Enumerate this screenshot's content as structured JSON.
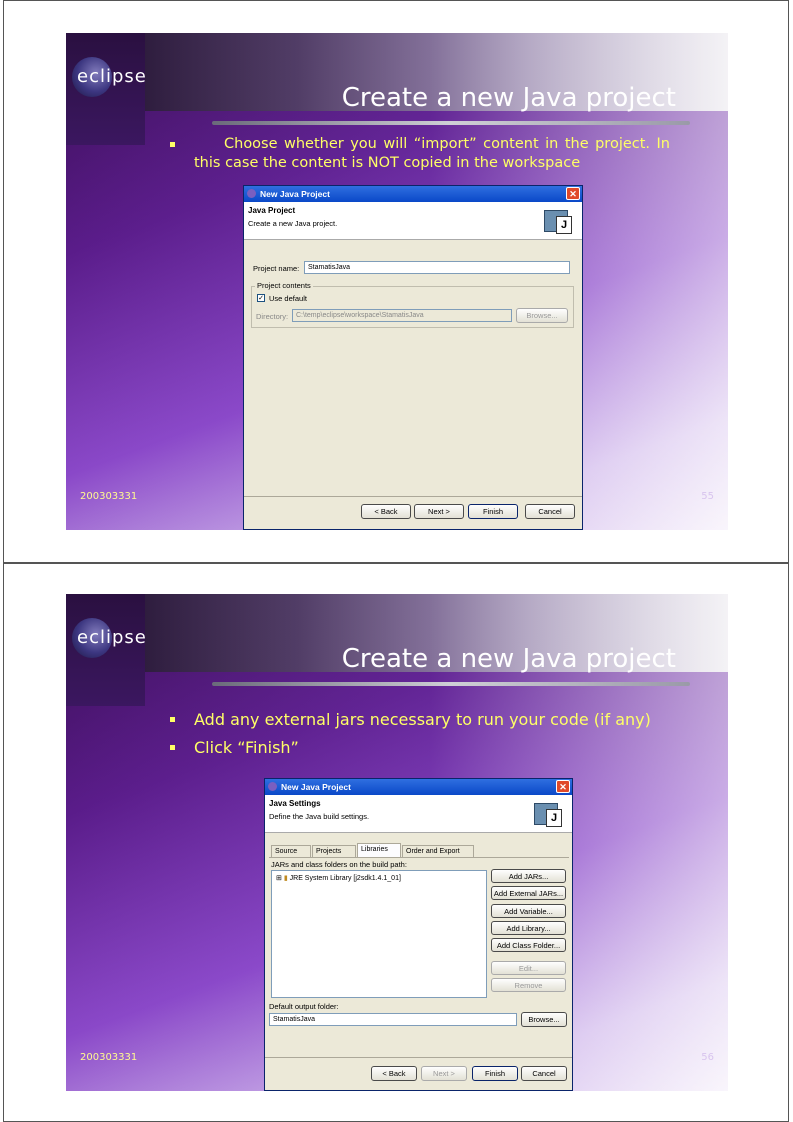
{
  "slides": [
    {
      "logo_text": "eclipse",
      "title": "Create a new Java project",
      "bullets": [
        "Choose whether you will “import” content in the project. In this case the content is NOT copied in the workspace"
      ],
      "footer_left": "200303331",
      "page_number": "55",
      "dialog": {
        "window_title": "New Java Project",
        "header_title": "Java Project",
        "header_desc": "Create a new Java project.",
        "project_name_label": "Project name:",
        "project_name_value": "StamatisJava",
        "group_label": "Project contents",
        "use_default_label": "Use default",
        "use_default_checked": "✓",
        "directory_label": "Directory:",
        "directory_value": "C:\\temp\\eclipse\\workspace\\StamatisJava",
        "browse_label": "Browse...",
        "back_label": "< Back",
        "next_label": "Next >",
        "finish_label": "Finish",
        "cancel_label": "Cancel"
      }
    },
    {
      "logo_text": "eclipse",
      "title": "Create a new Java project",
      "bullets": [
        "Add any external jars necessary to run your code (if any)",
        "Click “Finish”"
      ],
      "footer_left": "200303331",
      "page_number": "56",
      "dialog": {
        "window_title": "New Java Project",
        "header_title": "Java Settings",
        "header_desc": "Define the Java build settings.",
        "tabs": [
          "Source",
          "Projects",
          "Libraries",
          "Order and Export"
        ],
        "jars_label": "JARs and class folders on the build path:",
        "tree_item": "JRE System Library [j2sdk1.4.1_01]",
        "side_buttons": [
          "Add JARs...",
          "Add External JARs...",
          "Add Variable...",
          "Add Library...",
          "Add Class Folder...",
          "Edit...",
          "Remove"
        ],
        "output_label": "Default output folder:",
        "output_value": "StamatisJava",
        "browse_label": "Browse...",
        "back_label": "< Back",
        "next_label": "Next >",
        "finish_label": "Finish",
        "cancel_label": "Cancel"
      }
    }
  ]
}
